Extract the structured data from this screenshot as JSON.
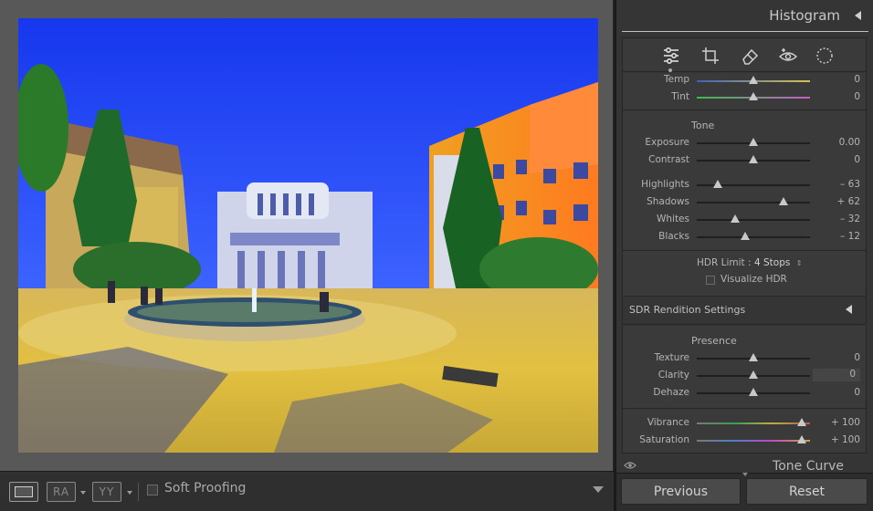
{
  "histogram": {
    "title": "Histogram"
  },
  "toolbar": {
    "ra_label": "RA",
    "yy_label": "YY",
    "soft_proofing_label": "Soft Proofing"
  },
  "wb": {
    "temp": {
      "label": "Temp",
      "value": "0"
    },
    "tint": {
      "label": "Tint",
      "value": "0"
    }
  },
  "tone": {
    "title": "Tone",
    "exposure": {
      "label": "Exposure",
      "value": "0.00"
    },
    "contrast": {
      "label": "Contrast",
      "value": "0"
    },
    "highlights": {
      "label": "Highlights",
      "value": "– 63"
    },
    "shadows": {
      "label": "Shadows",
      "value": "+ 62"
    },
    "whites": {
      "label": "Whites",
      "value": "– 32"
    },
    "blacks": {
      "label": "Blacks",
      "value": "– 12"
    },
    "hdr_limit_label": "HDR Limit :",
    "hdr_limit_value": "4 Stops",
    "visualize_hdr_label": "Visualize HDR"
  },
  "sdr": {
    "label": "SDR Rendition Settings"
  },
  "presence": {
    "title": "Presence",
    "texture": {
      "label": "Texture",
      "value": "0"
    },
    "clarity": {
      "label": "Clarity",
      "value": "0"
    },
    "dehaze": {
      "label": "Dehaze",
      "value": "0"
    },
    "vibrance": {
      "label": "Vibrance",
      "value": "+ 100"
    },
    "saturation": {
      "label": "Saturation",
      "value": "+ 100"
    }
  },
  "tone_curve": {
    "label": "Tone Curve"
  },
  "buttons": {
    "previous": "Previous",
    "reset": "Reset"
  },
  "icons": [
    "sliders-icon",
    "crop-icon",
    "eraser-icon",
    "redeye-icon",
    "mask-icon",
    "eye-icon"
  ],
  "colors": {
    "panel": "#353535",
    "section": "#3a3a3a",
    "canvas": "#585858",
    "sky": "#1e3cf0"
  }
}
